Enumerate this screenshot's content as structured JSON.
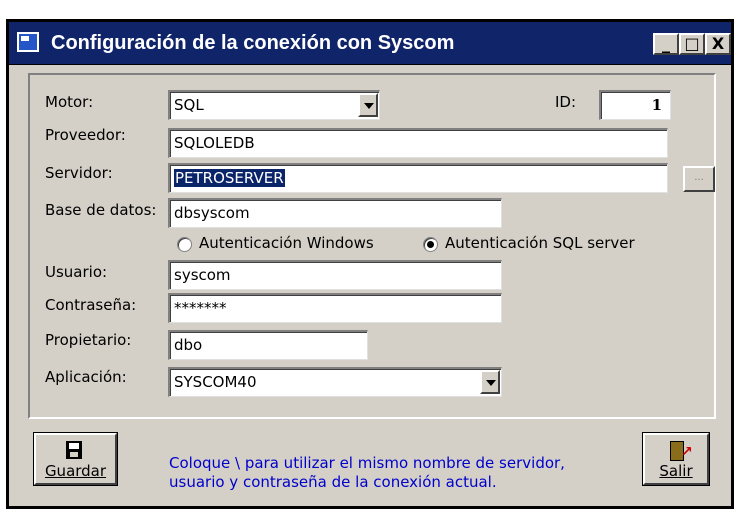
{
  "window": {
    "title": "Configuración de la conexión con Syscom",
    "controls": {
      "minimize": "_",
      "maximize": "□",
      "close": "X"
    }
  },
  "form": {
    "motor_label": "Motor:",
    "motor_value": "SQL",
    "id_label": "ID:",
    "id_value": "1",
    "proveedor_label": "Proveedor:",
    "proveedor_value": "SQLOLEDB",
    "servidor_label": "Servidor:",
    "servidor_value": "PETROSERVER",
    "browse_label": "...",
    "base_label": "Base de datos:",
    "base_value": "dbsyscom",
    "auth_windows_label": "Autenticación Windows",
    "auth_sql_label": "Autenticación SQL server",
    "auth_selected": "sql",
    "usuario_label": "Usuario:",
    "usuario_value": "syscom",
    "contrasena_label": "Contraseña:",
    "contrasena_value": "*******",
    "propietario_label": "Propietario:",
    "propietario_value": "dbo",
    "aplicacion_label": "Aplicación:",
    "aplicacion_value": "SYSCOM40"
  },
  "footer": {
    "save_label": "Guardar",
    "hint_line1": "Coloque \\ para utilizar el mismo nombre de servidor,",
    "hint_line2": "usuario y contraseña de la conexión actual.",
    "exit_label": "Salir"
  },
  "icons": {
    "app": "app-window-icon",
    "save": "floppy-disk-icon",
    "exit": "exit-door-icon"
  },
  "colors": {
    "titlebar": "#10246a",
    "face": "#d4d0c8",
    "hint_text": "#0000cc",
    "selection": "#0a246a"
  }
}
